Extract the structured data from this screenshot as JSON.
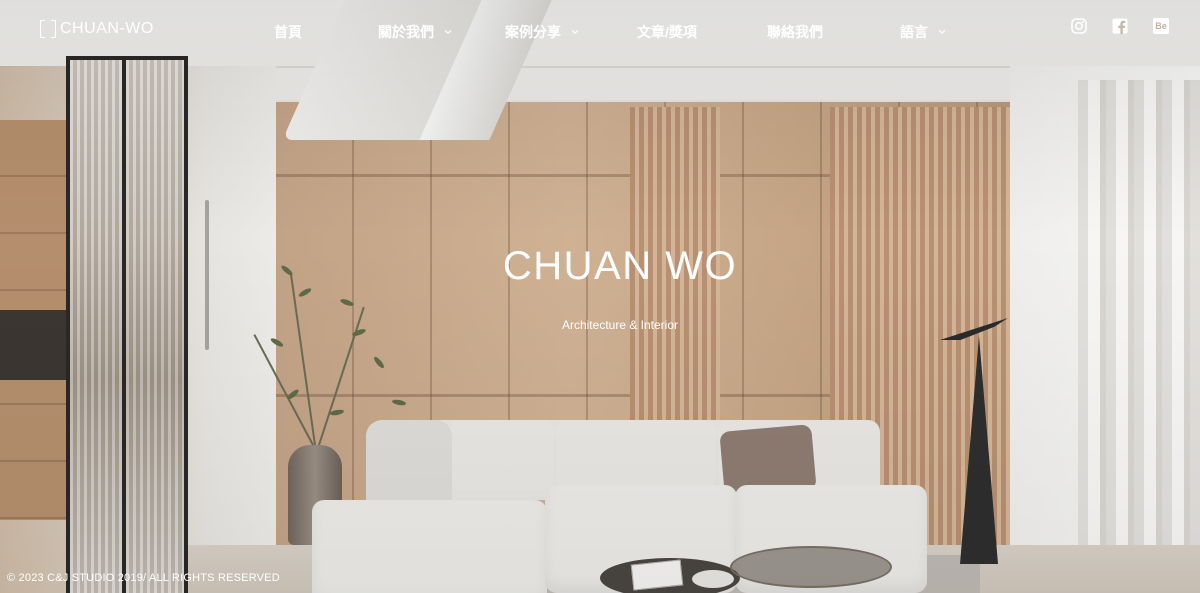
{
  "brand": {
    "name": "CHUAN-WO"
  },
  "nav": {
    "items": [
      {
        "label": "首頁",
        "has_dropdown": false
      },
      {
        "label": "關於我們",
        "has_dropdown": true
      },
      {
        "label": "案例分享",
        "has_dropdown": true
      },
      {
        "label": "文章/獎項",
        "has_dropdown": false
      },
      {
        "label": "聯絡我們",
        "has_dropdown": false
      },
      {
        "label": "語言",
        "has_dropdown": true
      }
    ]
  },
  "social": [
    {
      "icon": "instagram-icon"
    },
    {
      "icon": "facebook-icon"
    },
    {
      "icon": "behance-icon",
      "text": "Be"
    }
  ],
  "hero": {
    "title": "CHUAN WO",
    "subtitle": "Architecture & Interior"
  },
  "footer": {
    "copyright": "© 2023 C&J STUDIO 2019/ ALL RIGHTS RESERVED"
  },
  "colors": {
    "text": "#ffffff"
  }
}
